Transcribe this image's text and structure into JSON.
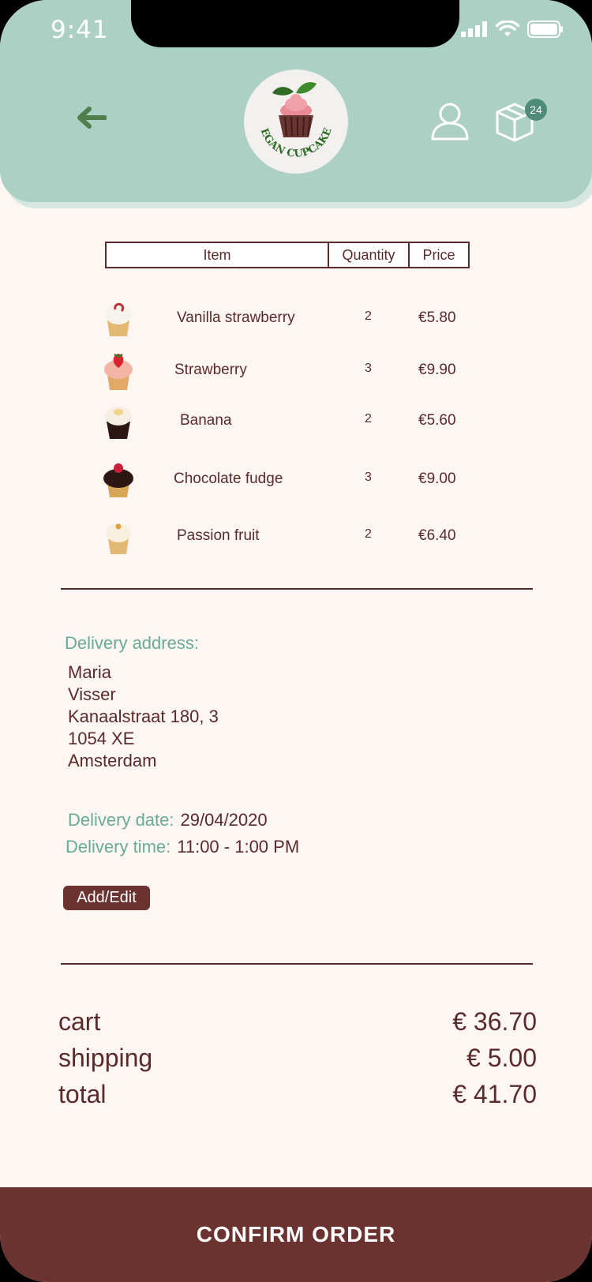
{
  "status_bar": {
    "time": "9:41"
  },
  "header": {
    "logo_text": "VEGAN CUPCAKES",
    "cart_count": "24"
  },
  "table": {
    "headers": {
      "item": "Item",
      "quantity": "Quantity",
      "price": "Price"
    },
    "rows": [
      {
        "name": "Vanilla strawberry",
        "qty": "2",
        "price": "€5.80",
        "image": "vanilla-strawberry-cupcake"
      },
      {
        "name": "Strawberry",
        "qty": "3",
        "price": "€9.90",
        "image": "strawberry-cupcake"
      },
      {
        "name": "Banana",
        "qty": "2",
        "price": "€5.60",
        "image": "banana-cupcake"
      },
      {
        "name": "Chocolate fudge",
        "qty": "3",
        "price": "€9.00",
        "image": "chocolate-fudge-cupcake"
      },
      {
        "name": "Passion fruit",
        "qty": "2",
        "price": "€6.40",
        "image": "passion-fruit-cupcake"
      }
    ]
  },
  "delivery": {
    "address_label": "Delivery address:",
    "address_lines": [
      "Maria",
      "Visser",
      "Kanaalstraat 180, 3",
      "1054 XE",
      "Amsterdam"
    ],
    "date_label": "Delivery date:",
    "date_value": "29/04/2020",
    "time_label": "Delivery time:",
    "time_value": "11:00 - 1:00 PM",
    "edit_button": "Add/Edit"
  },
  "summary": {
    "cart_label": "cart",
    "cart_value": "€ 36.70",
    "shipping_label": "shipping",
    "shipping_value": "€ 5.00",
    "total_label": "total",
    "total_value": "€ 41.70"
  },
  "confirm_button": "CONFIRM ORDER",
  "colors": {
    "header_bg": "#acd0c4",
    "accent_brown": "#6b3330",
    "text_brown": "#5a2b2b",
    "label_green": "#6aab96",
    "page_bg": "#fdf6f3"
  }
}
